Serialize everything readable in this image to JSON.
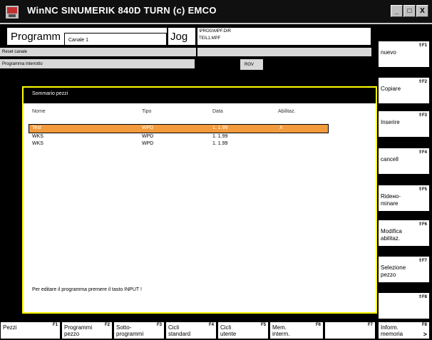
{
  "window": {
    "title": "WinNC SINUMERIK 840D TURN (c) EMCO",
    "minimize": "_",
    "maximize": "□",
    "close": "X"
  },
  "header": {
    "area": "Programm",
    "channel": "Canale 1",
    "mode": "Jog",
    "path_line1": "\\PROG\\MPF.DIR",
    "path_line2": "TEIL1.MPF",
    "reset_status": "Reset canale",
    "program_status": "Programma interrotto",
    "rov": "ROV"
  },
  "panel": {
    "title": "Sommario pezzi",
    "columns": {
      "name": "Nome",
      "type": "Tipo",
      "date": "Data",
      "enable": "Abilitaz."
    },
    "rows": [
      {
        "name": "Test",
        "type": "WPD",
        "date": "1. 1.99",
        "enable": "X"
      },
      {
        "name": "WKS",
        "type": "WPD",
        "date": "1. 1.99",
        "enable": ""
      },
      {
        "name": "WKS",
        "type": "WPD",
        "date": "1. 1.99",
        "enable": ""
      }
    ],
    "hint": "Per editare il programma premere il tasto INPUT !"
  },
  "softkeys_right": [
    {
      "line1": "nuevo",
      "line2": "",
      "num": "⇧F1"
    },
    {
      "line1": "Copiare",
      "line2": "",
      "num": "⇧F2"
    },
    {
      "line1": "Inserire",
      "line2": "",
      "num": "⇧F3"
    },
    {
      "line1": "cancell",
      "line2": "",
      "num": "⇧F4"
    },
    {
      "line1": "Ridено-",
      "line2": "minare",
      "num": "⇧F5"
    },
    {
      "line1": "Modifica",
      "line2": "abilitaz.",
      "num": "⇧F6"
    },
    {
      "line1": "Selezione",
      "line2": "pezzo",
      "num": "⇧F7"
    },
    {
      "line1": "",
      "line2": "",
      "num": "⇧F8"
    }
  ],
  "softkeys_bottom": [
    {
      "line1": "Pezzi",
      "line2": "",
      "num": "F1"
    },
    {
      "line1": "Programmi",
      "line2": "pezzo",
      "num": "F2"
    },
    {
      "line1": "Sotto-",
      "line2": "programmi",
      "num": "F3"
    },
    {
      "line1": "Cicli",
      "line2": "standard",
      "num": "F4"
    },
    {
      "line1": "Cicli",
      "line2": "utente",
      "num": "F5"
    },
    {
      "line1": "Mem.",
      "line2": "interm.",
      "num": "F6"
    },
    {
      "line1": "",
      "line2": "",
      "num": "F7"
    },
    {
      "line1": "Inform.",
      "line2": "memoria",
      "num": "F8"
    }
  ],
  "more_arrow": ">"
}
